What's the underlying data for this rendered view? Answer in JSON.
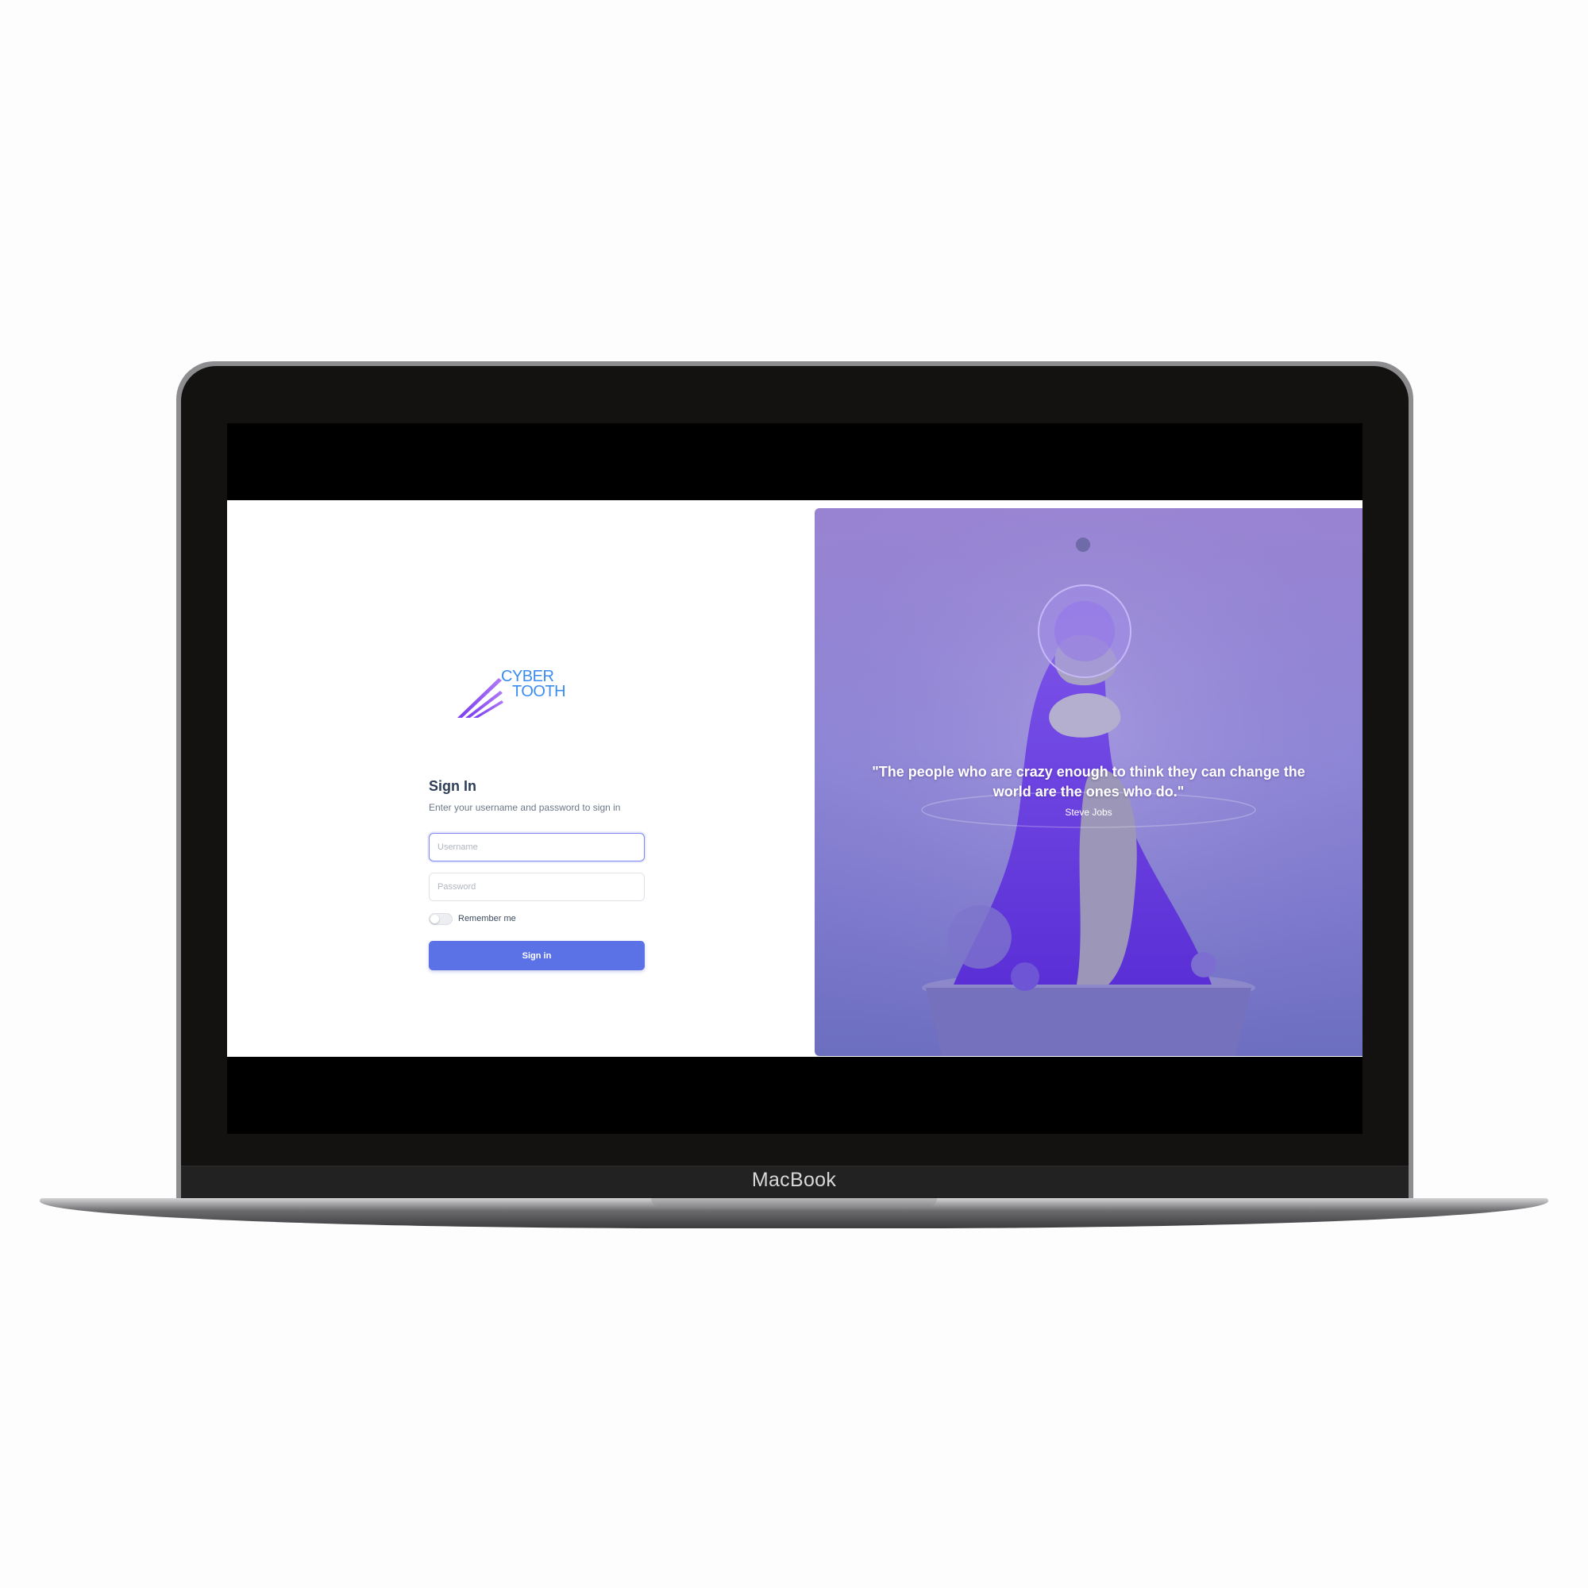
{
  "device": {
    "brand_label": "MacBook"
  },
  "login": {
    "logo": {
      "line1": "CYBER",
      "line2": "TOOTH"
    },
    "title": "Sign In",
    "subtitle": "Enter your username and password to sign in",
    "username_placeholder": "Username",
    "password_placeholder": "Password",
    "remember_label": "Remember me",
    "remember_checked": false,
    "submit_label": "Sign in"
  },
  "hero": {
    "quote": "\"The people who are crazy enough to think they can change the world are the ones who do.\"",
    "author": "Steve Jobs"
  },
  "colors": {
    "accent": "#5b72e6",
    "logo_blue": "#3a8cf0",
    "logo_purple": "#7b3df0",
    "panel_purple": "#8e86d6"
  }
}
